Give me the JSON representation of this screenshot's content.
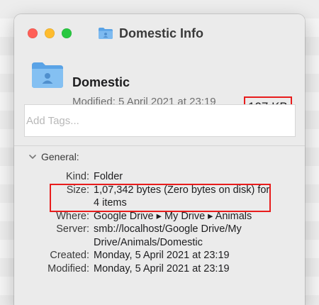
{
  "window": {
    "title": "Domestic Info",
    "title_icon": "folder-icon",
    "controls": [
      "close-button",
      "minimize-button",
      "zoom-button"
    ]
  },
  "header": {
    "name": "Domestic",
    "modified": "Modified: 5 April 2021 at 23:19",
    "size": "107 KB",
    "icon": "shared-folder-icon"
  },
  "tags": {
    "placeholder": "Add Tags...",
    "value": ""
  },
  "general": {
    "label": "General:",
    "expanded": true,
    "rows": [
      {
        "key": "Kind:",
        "value": "Folder"
      },
      {
        "key": "Size:",
        "value": "1,07,342 bytes (Zero bytes on disk) for 4 items"
      },
      {
        "key": "Where:",
        "value": "Google Drive ▸ My Drive ▸ Animals"
      },
      {
        "key": "Server:",
        "value": "smb://localhost/Google Drive/My Drive/Animals/Domestic"
      },
      {
        "key": "Created:",
        "value": "Monday, 5 April 2021 at 23:19"
      },
      {
        "key": "Modified:",
        "value": "Monday, 5 April 2021 at 23:19"
      }
    ]
  },
  "colors": {
    "highlight": "#e81c1c",
    "folder": "#64a8e6",
    "close": "#ff5f57",
    "minimize": "#febc2e",
    "zoom": "#28c840"
  }
}
